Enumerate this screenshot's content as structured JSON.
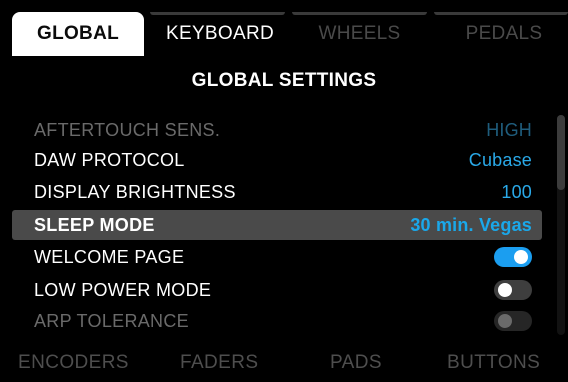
{
  "top_tabs": [
    {
      "label": "GLOBAL",
      "state": "active"
    },
    {
      "label": "KEYBOARD",
      "state": "normal"
    },
    {
      "label": "WHEELS",
      "state": "dim"
    },
    {
      "label": "PEDALS",
      "state": "dim"
    }
  ],
  "section_title": "GLOBAL SETTINGS",
  "settings": [
    {
      "label": "AFTERTOUCH SENS.",
      "value": "HIGH",
      "state": "faded"
    },
    {
      "label": "DAW PROTOCOL",
      "value": "Cubase",
      "state": "normal"
    },
    {
      "label": "DISPLAY BRIGHTNESS",
      "value": "100",
      "state": "normal"
    },
    {
      "label": "SLEEP MODE",
      "value": "30 min. Vegas",
      "state": "selected"
    },
    {
      "label": "WELCOME PAGE",
      "toggle": "on"
    },
    {
      "label": "LOW POWER MODE",
      "toggle": "off"
    },
    {
      "label": "ARP TOLERANCE",
      "toggle": "off",
      "state": "faded"
    }
  ],
  "bottom_tabs": [
    "ENCODERS",
    "FADERS",
    "PADS",
    "BUTTONS"
  ],
  "colors": {
    "accent": "#2aa9e8",
    "toggle_on": "#1b9ef0",
    "selected_row": "#4a4a4a"
  }
}
